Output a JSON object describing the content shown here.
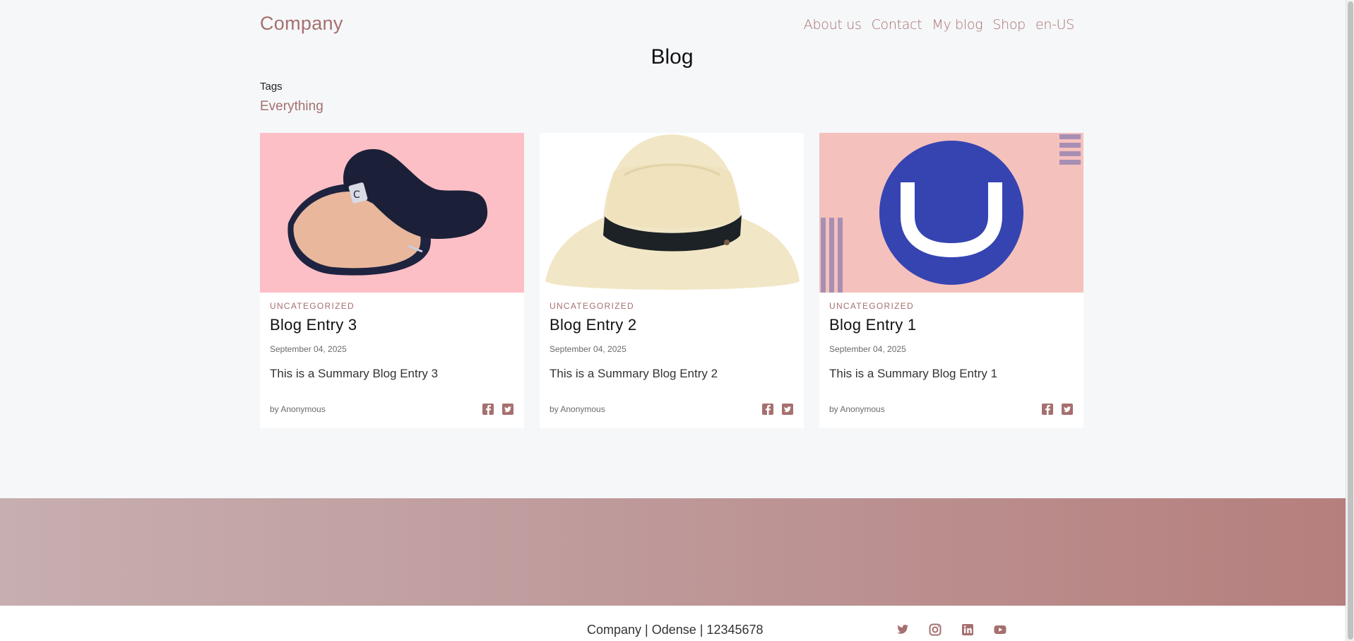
{
  "header": {
    "logo": "Company",
    "nav": [
      "About us",
      "Contact",
      "My blog",
      "Shop",
      "en-US"
    ]
  },
  "page": {
    "title": "Blog",
    "tags_label": "Tags",
    "tag": "Everything"
  },
  "cards": [
    {
      "category": "UNCATEGORIZED",
      "title": "Blog Entry 3",
      "date": "September 04, 2025",
      "summary": "This is a Summary Blog Entry 3",
      "author": "by Anonymous",
      "image": "navy-cap-photo"
    },
    {
      "category": "UNCATEGORIZED",
      "title": "Blog Entry 2",
      "date": "September 04, 2025",
      "summary": "This is a Summary Blog Entry 2",
      "author": "by Anonymous",
      "image": "straw-hat-photo"
    },
    {
      "category": "UNCATEGORIZED",
      "title": "Blog Entry 1",
      "date": "September 04, 2025",
      "summary": "This is a Summary Blog Entry 1",
      "author": "by Anonymous",
      "image": "umbraco-logo-image"
    }
  ],
  "footer": {
    "text": "Company | Odense | 12345678",
    "social_icons": [
      "twitter-icon",
      "instagram-icon",
      "linkedin-icon",
      "youtube-icon"
    ]
  },
  "colors": {
    "accent": "#a5706f",
    "background": "#f6f7f9",
    "band_start": "#c7aeb0",
    "band_end": "#b57f7d"
  }
}
